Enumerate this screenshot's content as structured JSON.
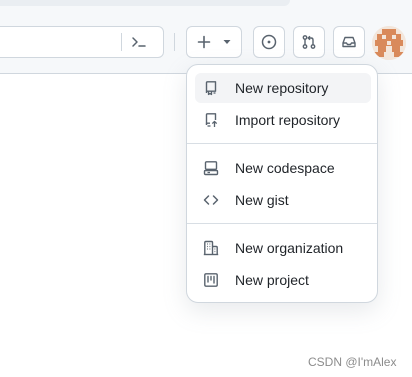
{
  "header": {
    "create_button_plus": "+",
    "icons": [
      "command-palette-icon",
      "plus-icon",
      "chevron-down-icon",
      "issue-opened-icon",
      "git-pull-request-icon",
      "inbox-icon"
    ]
  },
  "menu": {
    "items": [
      {
        "label": "New repository",
        "icon": "repo-icon",
        "active": true
      },
      {
        "label": "Import repository",
        "icon": "repo-push-icon"
      },
      {
        "label": "New codespace",
        "icon": "codespaces-icon"
      },
      {
        "label": "New gist",
        "icon": "code-icon"
      },
      {
        "label": "New organization",
        "icon": "organization-icon"
      },
      {
        "label": "New project",
        "icon": "project-icon"
      }
    ]
  },
  "watermark": "CSDN @I'mAlex",
  "colors": {
    "accent_bg": "#f6f8fa",
    "border": "#d0d7de",
    "avatar": "#d98a5b"
  }
}
